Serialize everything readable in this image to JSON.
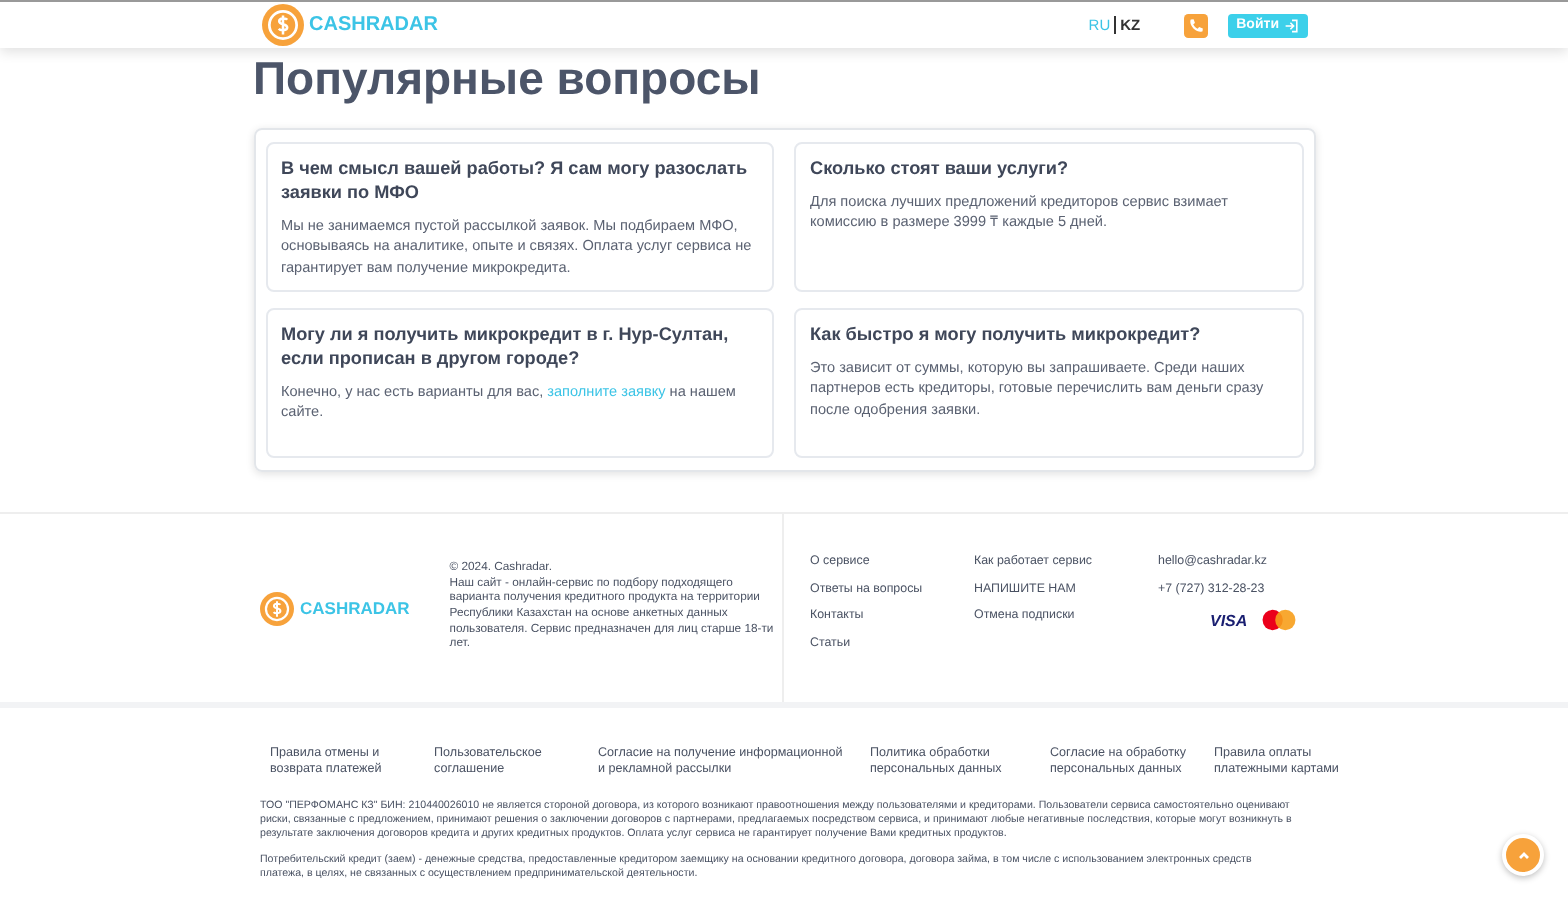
{
  "header": {
    "logo": "CASHRADAR",
    "languages": [
      {
        "label": "RU",
        "selected": true
      },
      {
        "label": "KZ",
        "selected": false
      }
    ],
    "login_button": "Войти"
  },
  "title": "Популярные вопросы",
  "faq": [
    {
      "question": "В чем смысл вашей работы? Я сам могу разослать заявки по МФО",
      "answer": "Мы не занимаемся пустой рассылкой заявок. Мы подбираем МФО, основываясь на аналитике, опыте и связях. Оплата услуг сервиса не гарантирует вам получение микрокредита."
    },
    {
      "question": "Сколько стоят ваши услуги?",
      "answer": "Для поиска лучших предложений кредиторов сервис взимает комиссию в размере 3999 ₸ каждые 5 дней."
    },
    {
      "question": "Могу ли я получить микрокредит в г. Нур-Султан, если прописан в другом городе?",
      "answer": "Конечно, у нас есть варианты для вас,",
      "link": "заполните заявку",
      "answer_end": "на нашем сайте."
    },
    {
      "question": "Как быстро я могу получить микрокредит?",
      "answer": "Это зависит от суммы, которую вы запрашиваете. Среди наших партнеров есть кредиторы, готовые перечислить вам деньги сразу после одобрения заявки."
    }
  ],
  "footer": {
    "logo": "CASHRADAR",
    "copyright": "© 2024. Cashradar.",
    "about": "Наш сайт - онлайн-сервис по подбору подходящего варианта получения кредитного продукта на территории Республики Казахстан на основе анкетных данных пользователя. Сервис предназначен для лиц старше 18-ти лет.",
    "links_1": [
      "О сервисе",
      "Ответы на вопросы",
      "Контакты",
      "Статьи"
    ],
    "links_2": [
      "Как работает сервис",
      "НАПИШИТЕ НАМ",
      "Отмена подписки"
    ],
    "email": "hello@cashradar.kz",
    "phone": "+7 (727) 312-28-23",
    "visa": "VISA",
    "documents": [
      "Правила отмены и возврата платежей",
      "Пользовательское соглашение",
      "Согласие на получение информационной и рекламной рассылки",
      "Политика обработки персональных данных",
      "Согласие на обработку персональных данных",
      "Правила оплаты платежными картами"
    ],
    "legal": [
      "ТОО \"ПЕРФОМАНС КЗ\" БИН: 210440026010 не является стороной договора, из которого возникают правоотношения между пользователями и кредиторами. Пользователи сервиса самостоятельно оценивают риски, связанные с предложением, принимают решения о заключении договоров с партнерами, предлагаемых посредством сервиса, и принимают любые негативные последствия, которые могут возникнуть в результате заключения договоров кредита и других кредитных продуктов. Оплата услуг сервиса не гарантирует получение Вами кредитных продуктов.",
      "Потребительский кредит (заем) - денежные средства, предоставленные кредитором заемщику на основании кредитного договора, договора займа, в том числе с использованием электронных средств платежа, в целях, не связанных с осуществлением предпринимательской деятельности."
    ]
  }
}
